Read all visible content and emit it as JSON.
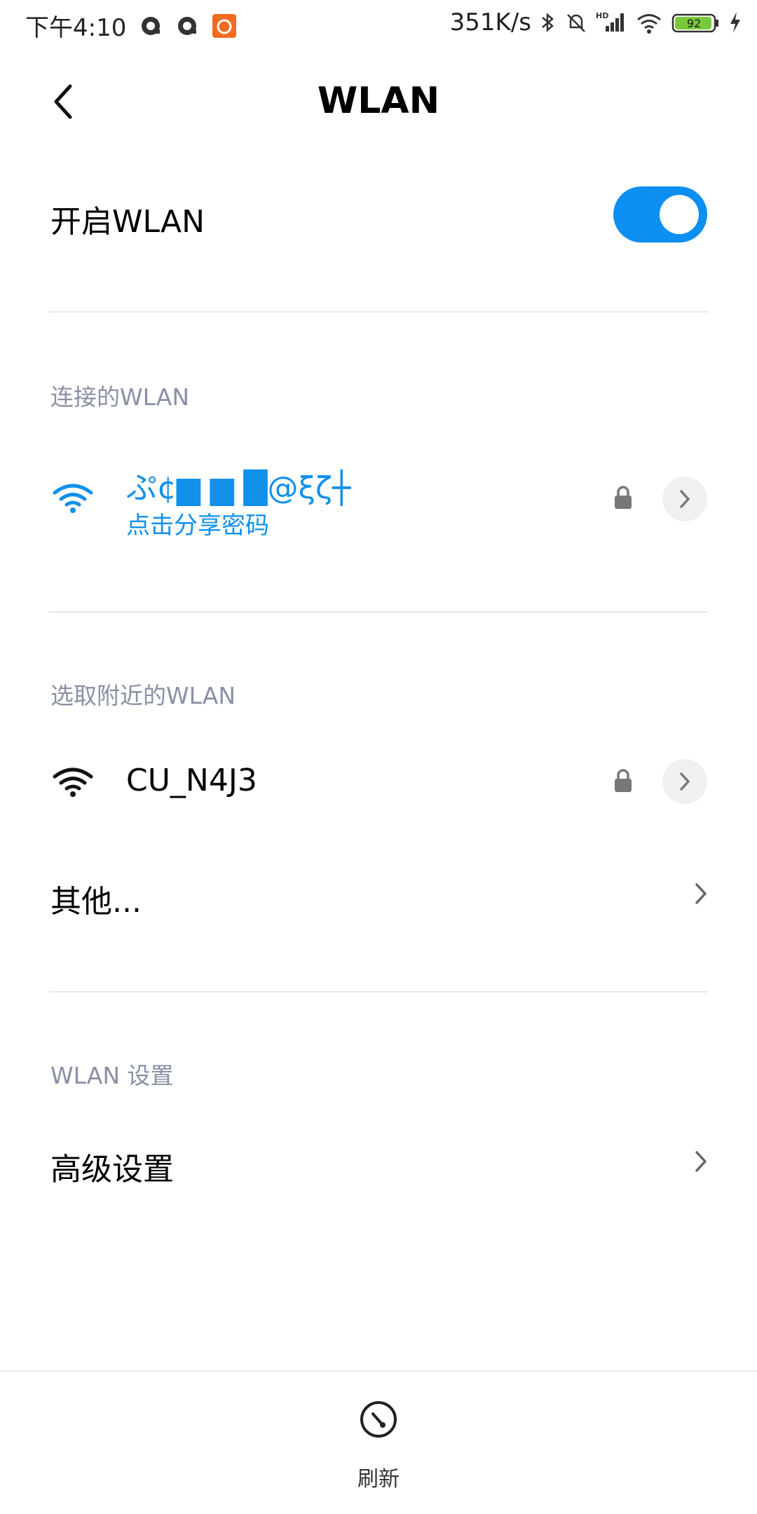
{
  "status_bar": {
    "time": "下午4:10",
    "speed": "351K/s",
    "hd_label": "HD",
    "battery": "92",
    "battery_color": "#79c93a"
  },
  "header": {
    "title": "WLAN"
  },
  "toggle_row": {
    "label": "开启WLAN",
    "enabled": true,
    "accent": "#0c8ff0"
  },
  "connected": {
    "section_label": "连接的WLAN",
    "network": {
      "name": "ぷ¢▆ ▆ █@ξζ┼",
      "subtitle": "点击分享密码",
      "icon": "wifi-icon",
      "secured": true
    }
  },
  "nearby": {
    "section_label": "选取附近的WLAN",
    "networks": [
      {
        "name": "CU_N4J3",
        "icon": "wifi-icon",
        "secured": true
      }
    ],
    "other_label": "其他..."
  },
  "settings": {
    "section_label": "WLAN 设置",
    "advanced_label": "高级设置"
  },
  "bottom": {
    "refresh_label": "刷新"
  }
}
